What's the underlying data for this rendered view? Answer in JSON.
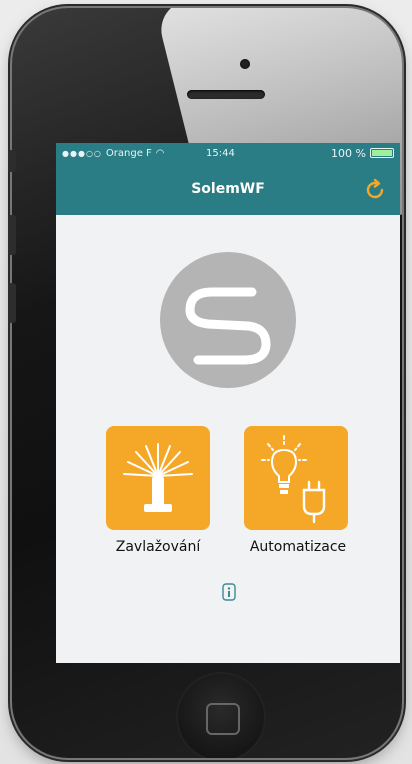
{
  "status_bar": {
    "carrier": "Orange F",
    "time": "15:44",
    "battery": "100 %"
  },
  "navbar": {
    "title": "SolemWF",
    "refresh_icon": "refresh-icon"
  },
  "main": {
    "logo_icon": "solem-logo",
    "tiles": [
      {
        "label": "Zavlažování",
        "icon": "sprinkler-icon"
      },
      {
        "label": "Automatizace",
        "icon": "bulb-plug-icon"
      }
    ],
    "info_icon": "info-icon"
  },
  "colors": {
    "navbar": "#2b7d85",
    "accent": "#f5a828",
    "screen_bg": "#f1f2f4",
    "logo_circle": "#b4b4b4"
  }
}
